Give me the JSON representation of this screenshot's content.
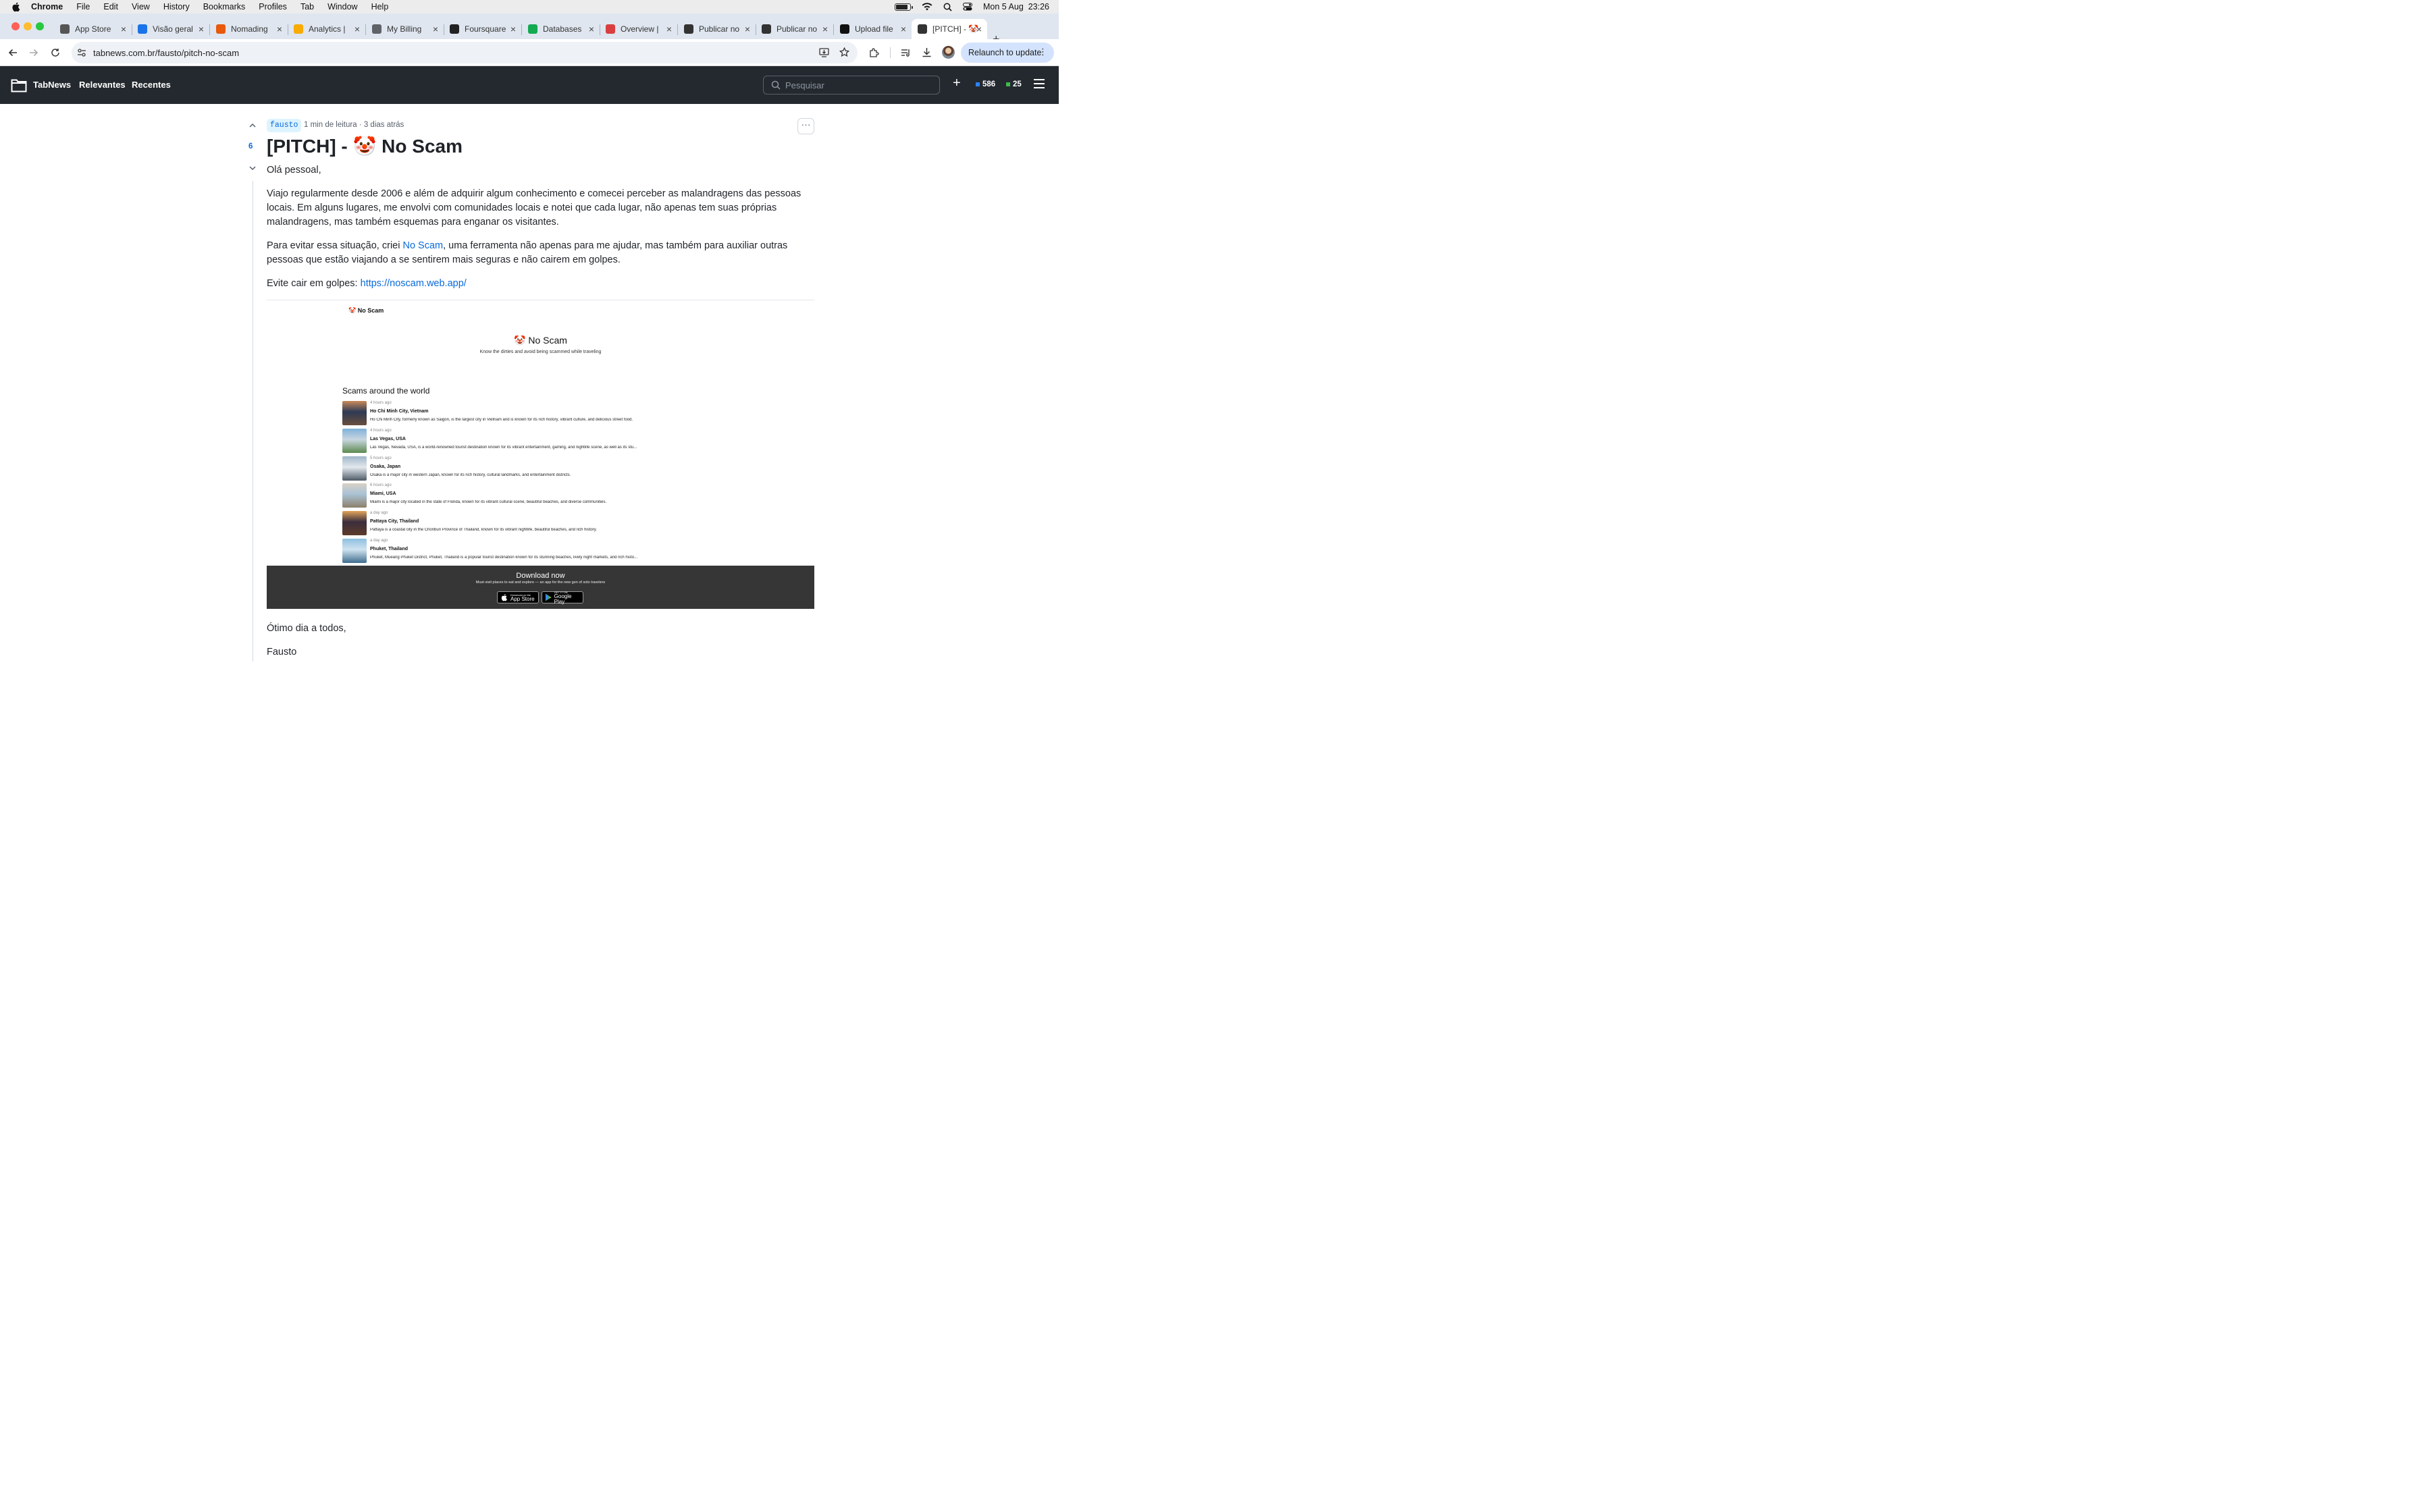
{
  "menubar": {
    "app": "Chrome",
    "items": [
      "File",
      "Edit",
      "View",
      "History",
      "Bookmarks",
      "Profiles",
      "Tab",
      "Window",
      "Help"
    ],
    "datetime": "Mon 5 Aug  23:26"
  },
  "tabs": [
    {
      "title": "App Store",
      "icon": "apple-icon",
      "color": "#555555"
    },
    {
      "title": "Visão geral",
      "icon": "play-console-icon",
      "color": "#1a73e8"
    },
    {
      "title": "Nomading",
      "icon": "flame-icon",
      "color": "#e8590c"
    },
    {
      "title": "Analytics |",
      "icon": "analytics-icon",
      "color": "#f9ab00"
    },
    {
      "title": "My Billing",
      "icon": "gear-icon",
      "color": "#5f6368"
    },
    {
      "title": "Foursquare",
      "icon": "foursquare-icon",
      "color": "#222222"
    },
    {
      "title": "Databases",
      "icon": "mongodb-leaf-icon",
      "color": "#13aa52"
    },
    {
      "title": "Overview |",
      "icon": "bc-icon",
      "color": "#d93f3f"
    },
    {
      "title": "Publicar no",
      "icon": "folder-icon",
      "color": "#333333"
    },
    {
      "title": "Publicar no",
      "icon": "folder-icon",
      "color": "#333333"
    },
    {
      "title": "Upload file",
      "icon": "github-icon",
      "color": "#111111"
    },
    {
      "title": "[PITCH] - 🤡",
      "icon": "folder-icon",
      "color": "#333333",
      "active": true
    }
  ],
  "toolbar": {
    "url": "tabnews.com.br/fausto/pitch-no-scam",
    "relaunch": "Relaunch to update"
  },
  "site": {
    "brand": "TabNews",
    "nav": [
      "Relevantes",
      "Recentes"
    ],
    "search_placeholder": "Pesquisar",
    "tabcoins": "586",
    "tabcash": "25",
    "accent_blue": "#0969da",
    "accent_green": "#2da44e"
  },
  "article": {
    "votes": "6",
    "author": "fausto",
    "meta": "1 min de leitura · 3 dias atrás",
    "title": "[PITCH] - 🤡 No Scam",
    "greeting": "Olá pessoal,",
    "p1": "Viajo regularmente desde 2006 e além de adquirir algum conhecimento e comecei perceber as malandragens das pessoas locais. Em alguns lugares, me envolvi com comunidades locais e notei que cada lugar, não apenas tem suas próprias malandragens, mas também esquemas para enganar os visitantes.",
    "p2_before": "Para evitar essa situação, criei ",
    "p2_link": "No Scam",
    "p2_after": ", uma ferramenta não apenas para me ajudar, mas também para auxiliar outras pessoas que estão viajando a se sentirem mais seguras e não cairem em golpes.",
    "p3_before": "Evite cair em golpes: ",
    "p3_link": "https://noscam.web.app/",
    "closing": "Ótimo dia a todos,",
    "signature": "Fausto"
  },
  "embed": {
    "brand": "🤡 No Scam",
    "hero_title": "🤡 No Scam",
    "hero_subtitle": "Know the dirties and avoid being scammed while traveling",
    "section_title": "Scams around the world",
    "scams": [
      {
        "time": "4 hours ago",
        "city": "Ho Chi Minh City, Vietnam",
        "desc": "Ho Chi Minh City, formerly known as Saigon, is the largest city in Vietnam and is known for its rich history, vibrant culture, and delicious street food."
      },
      {
        "time": "4 hours ago",
        "city": "Las Vegas, USA",
        "desc": "Las Vegas, Nevada, USA, is a world-renowned tourist destination known for its vibrant entertainment, gaming, and nightlife scene, as well as its stu..."
      },
      {
        "time": "5 hours ago",
        "city": "Osaka, Japan",
        "desc": "Osaka is a major city in western Japan, known for its rich history, cultural landmarks, and entertainment districts."
      },
      {
        "time": "6 hours ago",
        "city": "Miami, USA",
        "desc": "Miami is a major city located in the state of Florida, known for its vibrant cultural scene, beautiful beaches, and diverse communities."
      },
      {
        "time": "a day ago",
        "city": "Pattaya City, Thailand",
        "desc": "Pattaya is a coastal city in the Chonburi Province of Thailand, known for its vibrant nightlife, beautiful beaches, and rich history."
      },
      {
        "time": "a day ago",
        "city": "Phuket, Thailand",
        "desc": "Phuket, Mueang Phuket District, Phuket, Thailand is a popular tourist destination known for its stunning beaches, lively night markets, and rich histo..."
      }
    ],
    "download_title": "Download now",
    "download_subtitle": "Must-visit places to eat and explore — an app for the new gen of solo travelers",
    "appstore_small": "Download on the",
    "appstore_large": "App Store",
    "googleplay_small": "GET IT ON",
    "googleplay_large": "Google Play"
  }
}
